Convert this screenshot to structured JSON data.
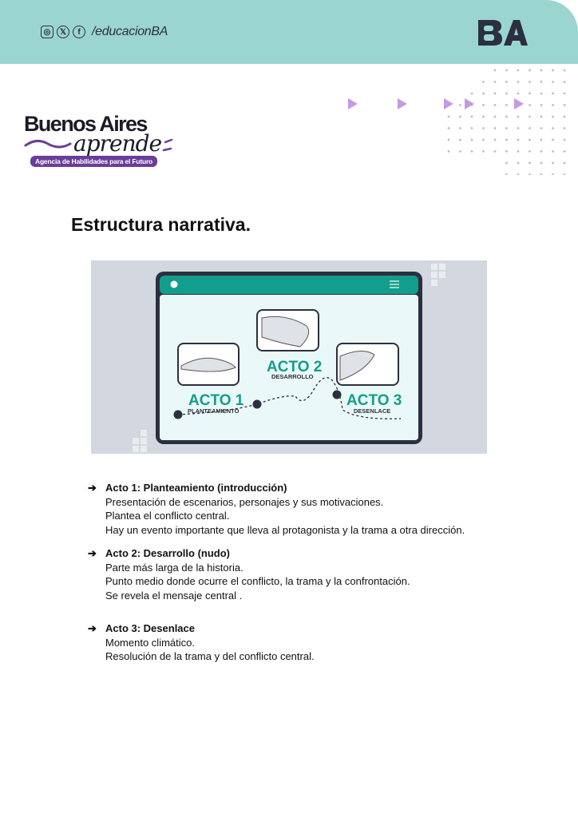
{
  "header": {
    "social_handle": "/educacionBA",
    "social_icons": [
      "instagram-icon",
      "x-icon",
      "facebook-icon"
    ],
    "logo_text": "BA"
  },
  "brand": {
    "line1": "Buenos Aires",
    "line2": "aprende",
    "tagline": "Agencia de Habilidades para el Futuro"
  },
  "page_title": "Estructura narrativa.",
  "figure": {
    "act1_title": "ACTO 1",
    "act1_sub": "PLANTEAMIENTO",
    "act2_title": "ACTO 2",
    "act2_sub": "DESARROLLO",
    "act3_title": "ACTO 3",
    "act3_sub": "DESENLACE"
  },
  "acts": [
    {
      "heading": "Acto 1: Planteamiento (introducción)",
      "lines": [
        "Presentación de escenarios, personajes y sus motivaciones.",
        "Plantea el conflicto central.",
        "Hay un evento importante que lleva al protagonista y la trama a otra dirección."
      ]
    },
    {
      "heading": "Acto 2: Desarrollo (nudo)",
      "lines": [
        "Parte más larga de la historia.",
        "Punto medio donde ocurre el conflicto, la trama y la confrontación.",
        "Se revela el mensaje central ."
      ]
    },
    {
      "heading": "Acto 3: Desenlace",
      "lines": [
        "Momento climático.",
        "Resolución de la trama y del conflicto central."
      ]
    }
  ],
  "colors": {
    "header_bg": "#9bd5cf",
    "teal": "#129e8c",
    "navy": "#2b2f3f",
    "purple": "#6a3d9a",
    "lilac": "#c49be0"
  }
}
